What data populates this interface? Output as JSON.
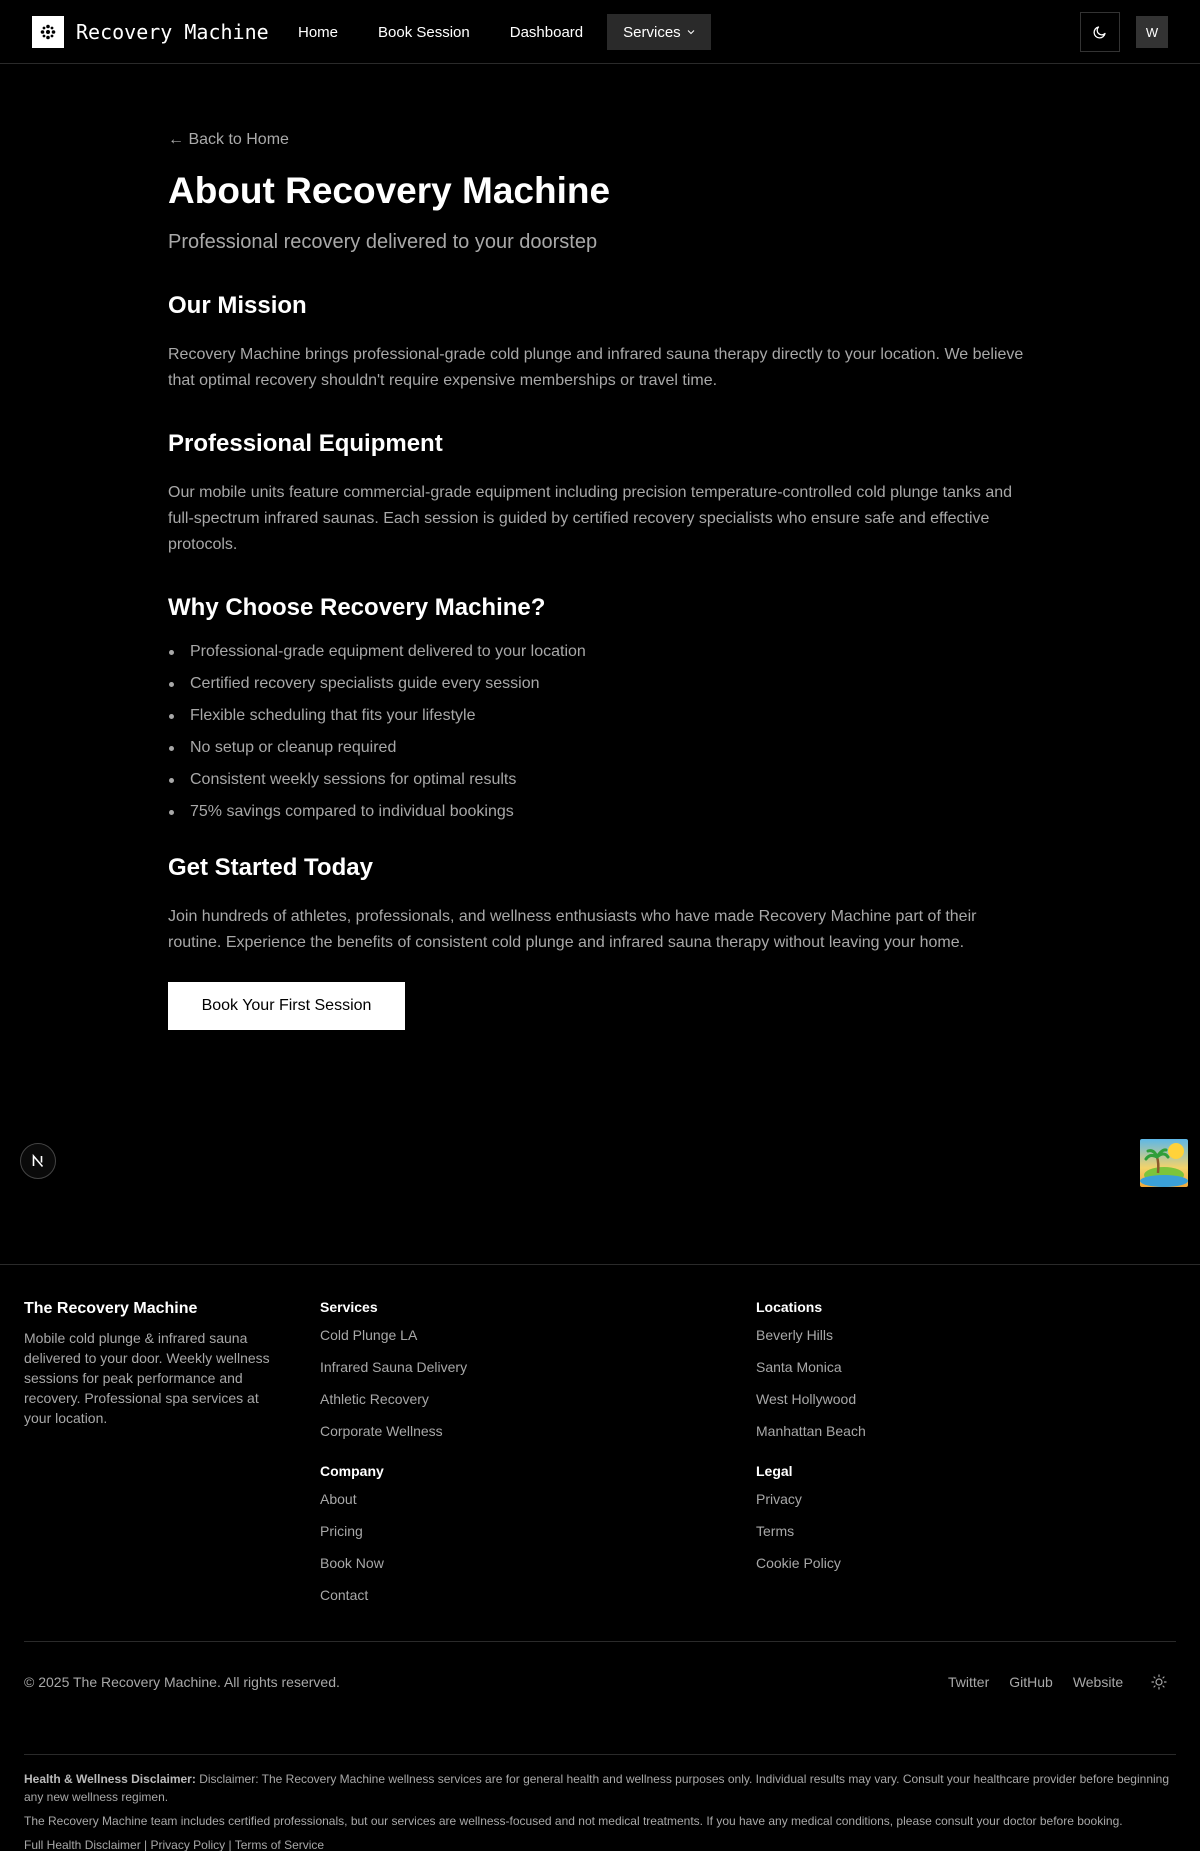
{
  "header": {
    "brand": "Recovery Machine",
    "nav": [
      "Home",
      "Book Session",
      "Dashboard"
    ],
    "services_label": "Services",
    "avatar_initial": "W"
  },
  "main": {
    "back_link": "← Back to Home",
    "title": "About Recovery Machine",
    "subtitle": "Professional recovery delivered to your doorstep",
    "mission": {
      "title": "Our Mission",
      "text": "Recovery Machine brings professional-grade cold plunge and infrared sauna therapy directly to your location. We believe that optimal recovery shouldn't require expensive memberships or travel time."
    },
    "equipment": {
      "title": "Professional Equipment",
      "text": "Our mobile units feature commercial-grade equipment including precision temperature-controlled cold plunge tanks and full-spectrum infrared saunas. Each session is guided by certified recovery specialists who ensure safe and effective protocols."
    },
    "why": {
      "title": "Why Choose Recovery Machine?",
      "items": [
        "Professional-grade equipment delivered to your location",
        "Certified recovery specialists guide every session",
        "Flexible scheduling that fits your lifestyle",
        "No setup or cleanup required",
        "Consistent weekly sessions for optimal results",
        "75% savings compared to individual bookings"
      ]
    },
    "start": {
      "title": "Get Started Today",
      "text": "Join hundreds of athletes, professionals, and wellness enthusiasts who have made Recovery Machine part of their routine. Experience the benefits of consistent cold plunge and infrared sauna therapy without leaving your home.",
      "cta": "Book Your First Session"
    }
  },
  "footer": {
    "brand": "The Recovery Machine",
    "description": "Mobile cold plunge & infrared sauna delivered to your door. Weekly wellness sessions for peak performance and recovery. Professional spa services at your location.",
    "services": {
      "title": "Services",
      "links": [
        "Cold Plunge LA",
        "Infrared Sauna Delivery",
        "Athletic Recovery",
        "Corporate Wellness"
      ]
    },
    "company": {
      "title": "Company",
      "links": [
        "About",
        "Pricing",
        "Book Now",
        "Contact"
      ]
    },
    "locations": {
      "title": "Locations",
      "links": [
        "Beverly Hills",
        "Santa Monica",
        "West Hollywood",
        "Manhattan Beach"
      ]
    },
    "legal": {
      "title": "Legal",
      "links": [
        "Privacy",
        "Terms",
        "Cookie Policy"
      ]
    },
    "copyright": "© 2025 The Recovery Machine. All rights reserved.",
    "social": [
      "Twitter",
      "GitHub",
      "Website"
    ],
    "disclaimer_label": "Health & Wellness Disclaimer:",
    "disclaimer_text": "Disclaimer: The Recovery Machine wellness services are for general health and wellness purposes only. Individual results may vary. Consult your healthcare provider before beginning any new wellness regimen.",
    "disclaimer_text2": "The Recovery Machine team includes certified professionals, but our services are wellness-focused and not medical treatments. If you have any medical conditions, please consult your doctor before booking.",
    "disclaimer_links": "Full Health Disclaimer | Privacy Policy | Terms of Service"
  }
}
